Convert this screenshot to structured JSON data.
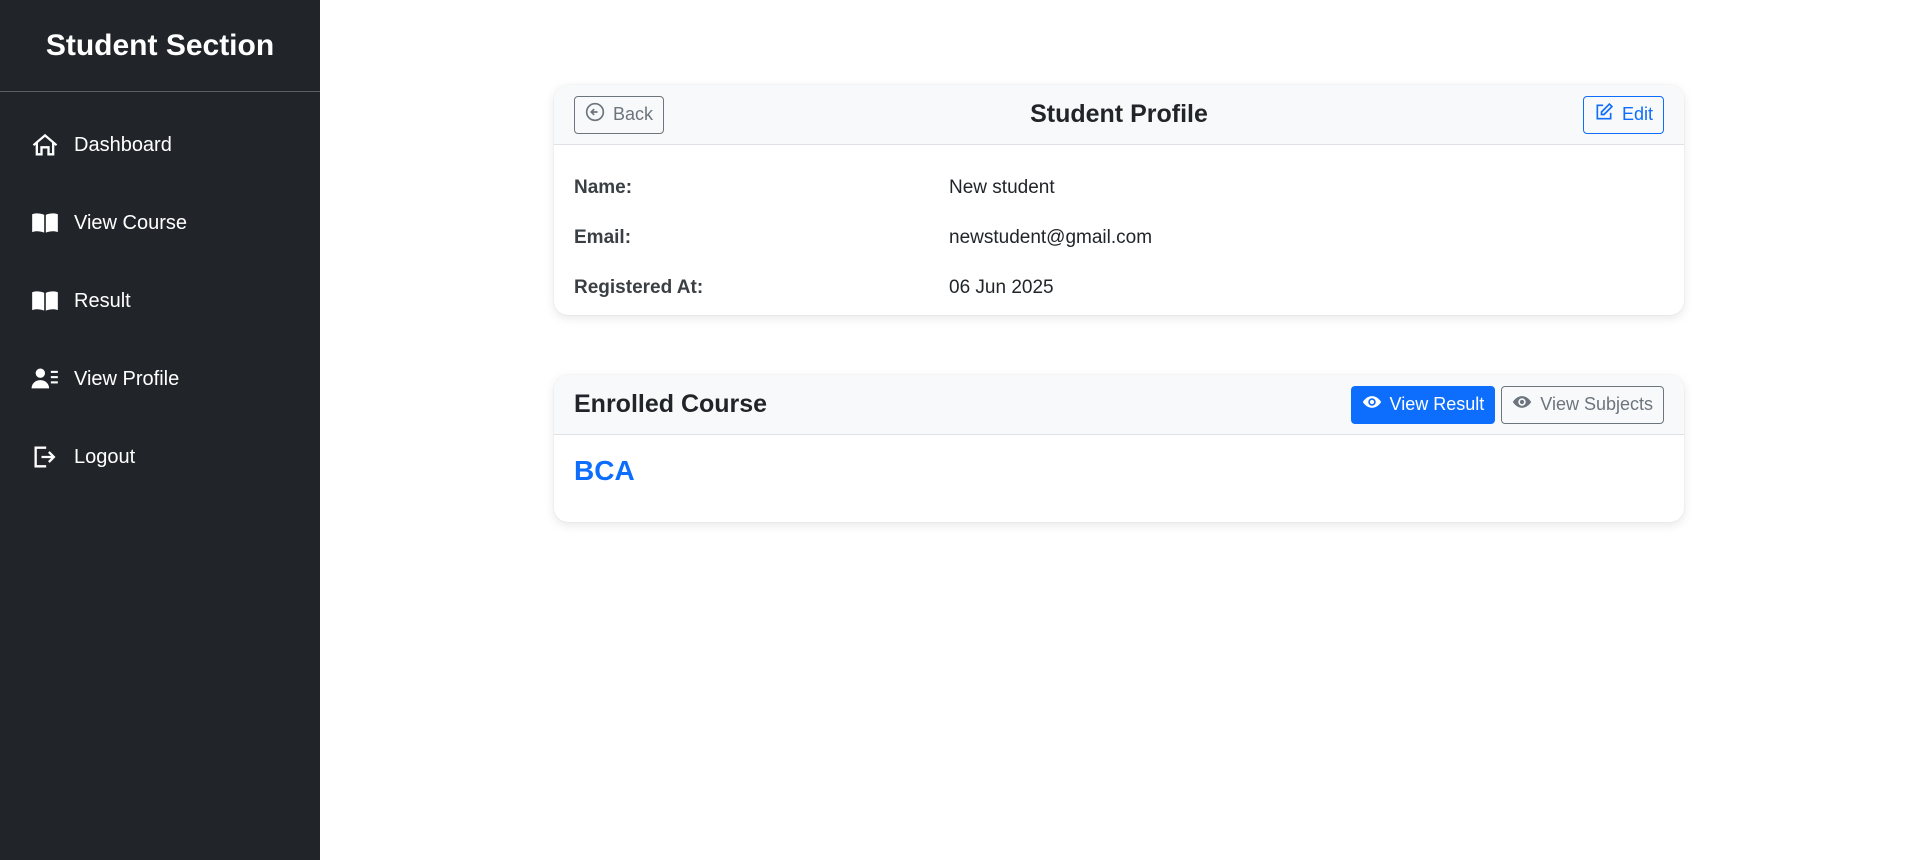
{
  "sidebar": {
    "brand": "Student Section",
    "items": [
      {
        "label": "Dashboard",
        "icon": "home-icon"
      },
      {
        "label": "View Course",
        "icon": "book-icon"
      },
      {
        "label": "Result",
        "icon": "book-icon"
      },
      {
        "label": "View Profile",
        "icon": "user-list-icon"
      },
      {
        "label": "Logout",
        "icon": "logout-icon"
      }
    ]
  },
  "profile": {
    "title": "Student Profile",
    "back_label": "Back",
    "edit_label": "Edit",
    "fields": [
      {
        "label": "Name:",
        "value": "New student"
      },
      {
        "label": "Email:",
        "value": "newstudent@gmail.com"
      },
      {
        "label": "Registered At:",
        "value": "06 Jun 2025"
      }
    ]
  },
  "course": {
    "title": "Enrolled Course",
    "view_result_label": "View Result",
    "view_subjects_label": "View Subjects",
    "name": "BCA"
  },
  "colors": {
    "sidebar_bg": "#212529",
    "primary": "#0d6efd",
    "secondary": "#6c757d",
    "header_bg": "#f8f9fa"
  }
}
